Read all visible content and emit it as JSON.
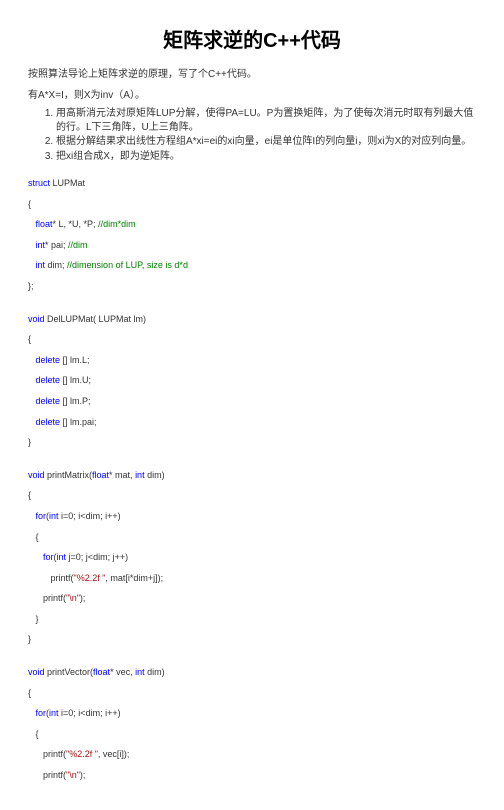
{
  "title": "矩阵求逆的C++代码",
  "intro1": "按照算法导论上矩阵求逆的原理，写了个C++代码。",
  "intro2": "有A*X=I，则X为inv（A）。",
  "steps": [
    "用高斯消元法对原矩阵LUP分解，使得PA=LU。P为置换矩阵，为了使每次消元时取有列最大值的行。L下三角阵，U上三角阵。",
    "根据分解结果求出线性方程组A*xi=ei的xi向量，ei是单位阵I的列向量i，则xi为X的对应列向量。",
    "把xi组合成X，即为逆矩阵。"
  ],
  "code": {
    "l1": "struct",
    "l1b": " LUPMat",
    "l2": "{",
    "l3a": "float",
    "l3b": "* L, *U, *P; ",
    "l3c": "//dim*dim",
    "l4a": "int",
    "l4b": "* pai; ",
    "l4c": "//dim",
    "l5a": "int",
    "l5b": " dim; ",
    "l5c": "//dimension of LUP, size is d*d",
    "l6": "};",
    "l7a": "void",
    "l7b": " DelLUPMat( LUPMat lm)",
    "l8": "{",
    "l9a": "delete",
    "l9b": " [] lm.L;",
    "l10a": "delete",
    "l10b": " [] lm.U;",
    "l11a": "delete",
    "l11b": " [] lm.P;",
    "l12a": "delete",
    "l12b": " [] lm.pai;",
    "l13": "}",
    "l14a": "void",
    "l14b": " printMatrix(",
    "l14c": "float",
    "l14d": "* mat, ",
    "l14e": "int",
    "l14f": " dim)",
    "l15": "{",
    "l16a": "for",
    "l16b": "(",
    "l16c": "int",
    "l16d": " i=0; i<dim; i++)",
    "l17": "   {",
    "l18a": "for",
    "l18b": "(",
    "l18c": "int",
    "l18d": " j=0; j<dim; j++)",
    "l19a": "         printf(",
    "l19b": "\"%2.2f \"",
    "l19c": ", mat[i*dim+j]);",
    "l20a": "      printf(",
    "l20b": "\"\\n\"",
    "l20c": ");",
    "l21": "   }",
    "l22": "}",
    "l23a": "void",
    "l23b": " printVector(",
    "l23c": "float",
    "l23d": "* vec, ",
    "l23e": "int",
    "l23f": " dim)",
    "l24": "{",
    "l25a": "for",
    "l25b": "(",
    "l25c": "int",
    "l25d": " i=0; i<dim; i++)",
    "l26": "   {",
    "l27a": "      printf(",
    "l27b": "\"%2.2f \"",
    "l27c": ", vec[i]);",
    "l28a": "      printf(",
    "l28b": "\"\\n\"",
    "l28c": ");"
  }
}
